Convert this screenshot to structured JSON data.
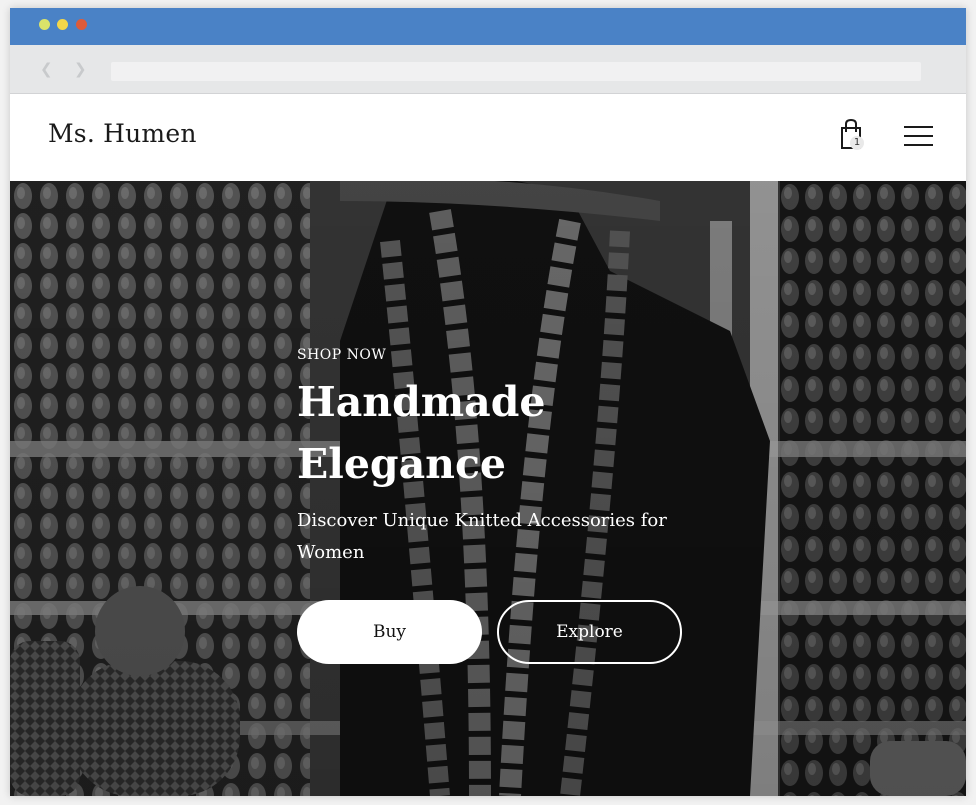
{
  "browser": {
    "window_dots": [
      "close",
      "minimize",
      "maximize"
    ],
    "nav": {
      "back_icon": "chevron-left-icon",
      "forward_icon": "chevron-right-icon"
    },
    "address": ""
  },
  "header": {
    "brand": "Ms. Humen",
    "cart_icon": "shopping-bag-icon",
    "cart_count": "1",
    "menu_icon": "hamburger-menu-icon"
  },
  "hero": {
    "eyebrow": "SHOP NOW",
    "headline_line1": "Handmade",
    "headline_line2": "Elegance",
    "subtitle": "Discover Unique Knitted Accessories for Women",
    "buy_label": "Buy",
    "explore_label": "Explore",
    "background": "black-and-white photo of knitted necklaces and hats on display"
  },
  "colors": {
    "titlebar": "#4a82c6",
    "dot_1": "#d9e36a",
    "dot_2": "#f3d64a",
    "dot_3": "#dd5b3a",
    "hero_text": "#ffffff",
    "header_bg": "#ffffff"
  }
}
